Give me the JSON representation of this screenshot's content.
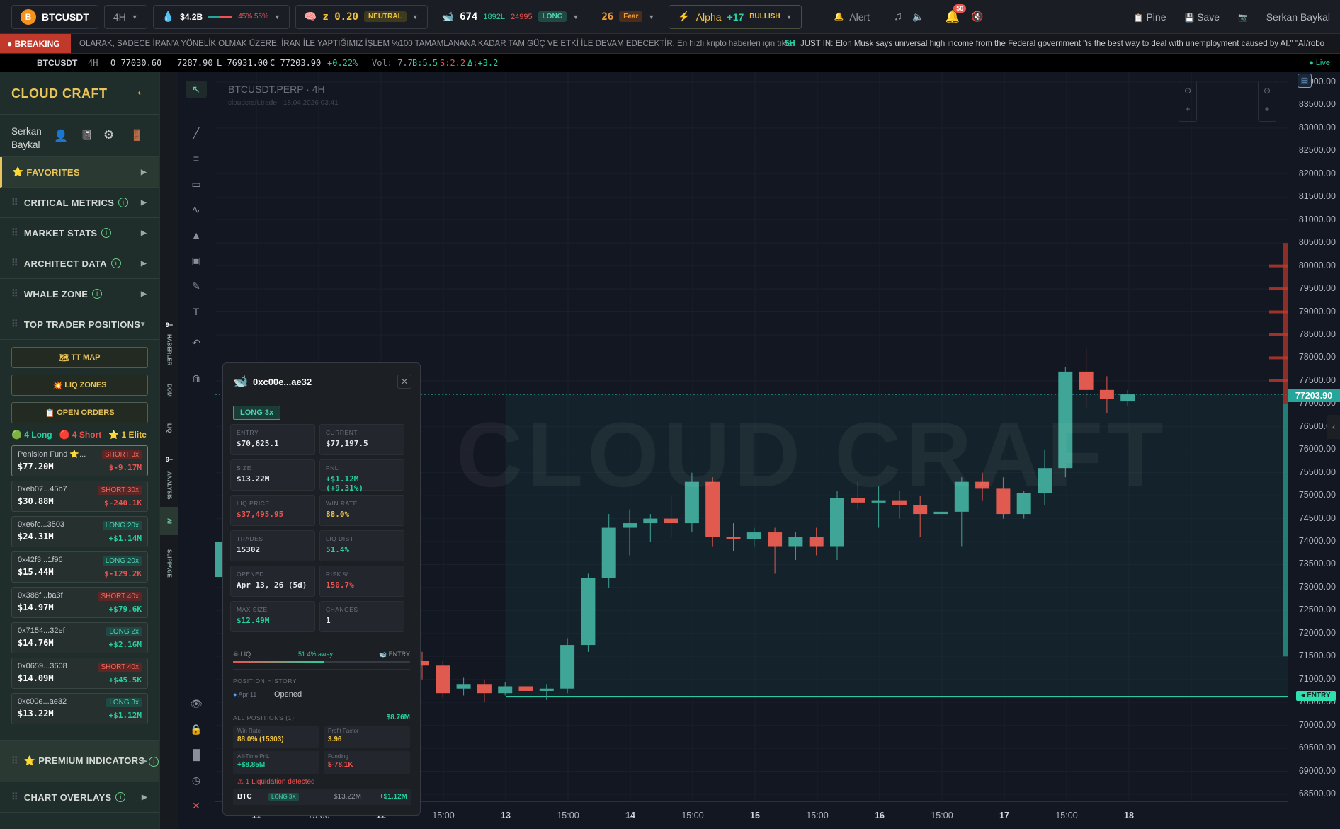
{
  "topbar": {
    "symbol": "BTCUSDT",
    "timeframe": "4H",
    "liquidity_value": "$4.2B",
    "liquidity_split": "45% 55%",
    "zscore_label": "z 0.20",
    "zscore_tag": "NEUTRAL",
    "whale_count": "674",
    "whale_long": "1892L",
    "whale_short": "24995",
    "whale_tag": "LONG",
    "fear_value": "26",
    "fear_label": "Fear",
    "alpha_label": "Alpha",
    "alpha_value": "+17",
    "alpha_tag": "BULLISH",
    "alert_label": "Alert",
    "notif_count": "50",
    "pine_label": "Pine",
    "save_label": "Save",
    "user_name": "Serkan Baykal"
  },
  "breaking": {
    "label": "BREAKING",
    "text1": "OLARAK, SADECE İRAN'A YÖNELİK OLMAK ÜZERE, İRAN İLE YAPTIĞIMIZ İŞLEM %100 TAMAMLANANA KADAR TAM GÜÇ VE ETKİ İLE DEVAM EDECEKTİR. En hızlı kripto haberleri için tıkla",
    "sep": "»",
    "time2": "5H",
    "text2": "JUST IN: Elon Musk says universal high income from the Federal government \"is the best way to deal with unemployment caused by AI.\" \"AI/robo"
  },
  "ohlc": {
    "symbol": "BTCUSDT",
    "tf": "4H",
    "open": "O 77030.60",
    "high": "7287.90",
    "low": "L 76931.00",
    "close": "C 77203.90",
    "change": "+0.22%",
    "vol": "Vol: 7.7",
    "buy": "B:5.5",
    "sell": "S:2.2",
    "delta": "Δ:+3.2",
    "live": "Live"
  },
  "sidebar": {
    "brand": "CLOUD CRAFT",
    "user_first": "Serkan",
    "user_last": "Baykal",
    "sections": [
      "FAVORITES",
      "CRITICAL METRICS",
      "MARKET STATS",
      "ARCHITECT DATA",
      "WHALE ZONE",
      "TOP TRADER POSITIONS"
    ],
    "buttons": [
      "TT MAP",
      "LIQ ZONES",
      "OPEN ORDERS"
    ],
    "summary": {
      "long": "4 Long",
      "short": "4 Short",
      "elite": "1 Elite"
    },
    "traders": [
      {
        "name": "Penision Fund ⭐...",
        "size": "$77.20M",
        "pos": "SHORT 3x",
        "pnl": "$-9.17M",
        "side": "short"
      },
      {
        "name": "0xeb07...45b7",
        "size": "$30.88M",
        "pos": "SHORT 30x",
        "pnl": "$-240.1K",
        "side": "short"
      },
      {
        "name": "0xe6fc...3503",
        "size": "$24.31M",
        "pos": "LONG 20x",
        "pnl": "+$1.14M",
        "side": "long"
      },
      {
        "name": "0x42f3...1f96",
        "size": "$15.44M",
        "pos": "LONG 20x",
        "pnl": "$-129.2K",
        "side": "long"
      },
      {
        "name": "0x388f...ba3f",
        "size": "$14.97M",
        "pos": "SHORT 40x",
        "pnl": "+$79.6K",
        "side": "short"
      },
      {
        "name": "0x7154...32ef",
        "size": "$14.76M",
        "pos": "LONG 2x",
        "pnl": "+$2.16M",
        "side": "long"
      },
      {
        "name": "0x0659...3608",
        "size": "$14.09M",
        "pos": "SHORT 40x",
        "pnl": "+$45.5K",
        "side": "short"
      },
      {
        "name": "0xc00e...ae32",
        "size": "$13.22M",
        "pos": "LONG 3x",
        "pnl": "+$1.12M",
        "side": "long"
      }
    ],
    "premium": "PREMIUM INDICATORS",
    "overlays": "CHART OVERLAYS"
  },
  "vtabs": {
    "badge1": "9+",
    "tab1": "HABERLER",
    "tab2": "DOM",
    "tab3": "LIQ",
    "badge2": "9+",
    "tab4": "ANALYSIS",
    "tab5": "AI",
    "tab6": "SLIPPAGE"
  },
  "chart": {
    "title": "BTCUSDT.PERP · 4H",
    "subtitle": "cloudcraft.trade · 18.04.2026 03:41",
    "watermark": "CLOUD CRAFT",
    "last_price": "77203.90",
    "entry_label": "ENTRY",
    "price_ticks": [
      "84000.00",
      "83500.00",
      "83000.00",
      "82500.00",
      "82000.00",
      "81500.00",
      "81000.00",
      "80500.00",
      "80000.00",
      "79500.00",
      "79000.00",
      "78500.00",
      "78000.00",
      "77500.00",
      "77000.00",
      "76500.00",
      "76000.00",
      "75500.00",
      "75000.00",
      "74500.00",
      "74000.00",
      "73500.00",
      "73000.00",
      "72500.00",
      "72000.00",
      "71500.00",
      "71000.00",
      "70500.00",
      "70000.00",
      "69500.00",
      "69000.00",
      "68500.00"
    ],
    "time_ticks": [
      "11",
      "15:00",
      "12",
      "15:00",
      "13",
      "15:00",
      "14",
      "15:00",
      "15",
      "15:00",
      "16",
      "15:00",
      "17",
      "15:00",
      "18"
    ]
  },
  "chart_data": {
    "type": "candlestick",
    "title": "BTCUSDT.PERP · 4H",
    "ylim": [
      68300,
      84200
    ],
    "entry": 70625.1,
    "last": 77203.9,
    "candles": [
      {
        "o": 71400,
        "h": 71600,
        "l": 71000,
        "c": 71300
      },
      {
        "o": 71300,
        "h": 71400,
        "l": 70600,
        "c": 70700
      },
      {
        "o": 70800,
        "h": 71050,
        "l": 70650,
        "c": 70900
      },
      {
        "o": 70900,
        "h": 71000,
        "l": 70500,
        "c": 70700
      },
      {
        "o": 70700,
        "h": 70950,
        "l": 70650,
        "c": 70850
      },
      {
        "o": 70850,
        "h": 70950,
        "l": 70600,
        "c": 70750
      },
      {
        "o": 70750,
        "h": 70900,
        "l": 70550,
        "c": 70800
      },
      {
        "o": 70800,
        "h": 71900,
        "l": 70700,
        "c": 71750
      },
      {
        "o": 71750,
        "h": 73300,
        "l": 71600,
        "c": 73200
      },
      {
        "o": 73200,
        "h": 74600,
        "l": 73000,
        "c": 74300
      },
      {
        "o": 74300,
        "h": 74700,
        "l": 73700,
        "c": 74400
      },
      {
        "o": 74400,
        "h": 74600,
        "l": 74000,
        "c": 74500
      },
      {
        "o": 74500,
        "h": 75000,
        "l": 74100,
        "c": 74400
      },
      {
        "o": 74400,
        "h": 75500,
        "l": 74200,
        "c": 75300
      },
      {
        "o": 75300,
        "h": 75400,
        "l": 73900,
        "c": 74100
      },
      {
        "o": 74100,
        "h": 74400,
        "l": 73800,
        "c": 74050
      },
      {
        "o": 74050,
        "h": 74300,
        "l": 73900,
        "c": 74200
      },
      {
        "o": 74200,
        "h": 74300,
        "l": 73300,
        "c": 73900
      },
      {
        "o": 73900,
        "h": 74200,
        "l": 73600,
        "c": 74100
      },
      {
        "o": 74100,
        "h": 74300,
        "l": 73700,
        "c": 73900
      },
      {
        "o": 73900,
        "h": 75100,
        "l": 73600,
        "c": 74950
      },
      {
        "o": 74950,
        "h": 75300,
        "l": 74700,
        "c": 74850
      },
      {
        "o": 74850,
        "h": 75200,
        "l": 74300,
        "c": 74900
      },
      {
        "o": 74900,
        "h": 75100,
        "l": 74500,
        "c": 74800
      },
      {
        "o": 74800,
        "h": 75000,
        "l": 74100,
        "c": 74600
      },
      {
        "o": 74600,
        "h": 75400,
        "l": 73350,
        "c": 74650
      },
      {
        "o": 74650,
        "h": 75400,
        "l": 73900,
        "c": 75300
      },
      {
        "o": 75300,
        "h": 75500,
        "l": 74900,
        "c": 75150
      },
      {
        "o": 75150,
        "h": 75400,
        "l": 74500,
        "c": 74600
      },
      {
        "o": 74600,
        "h": 75100,
        "l": 74500,
        "c": 75050
      },
      {
        "o": 75050,
        "h": 76000,
        "l": 74800,
        "c": 75600
      },
      {
        "o": 75600,
        "h": 77800,
        "l": 75400,
        "c": 77700
      },
      {
        "o": 77700,
        "h": 78200,
        "l": 76900,
        "c": 77300
      },
      {
        "o": 77300,
        "h": 77600,
        "l": 76800,
        "c": 77100
      },
      {
        "o": 77050,
        "h": 77300,
        "l": 76950,
        "c": 77204
      }
    ]
  },
  "popup": {
    "title": "0xc00e...ae32",
    "badge": "LONG 3x",
    "cells": [
      {
        "label": "ENTRY",
        "value": "$70,625.1",
        "color": "#e6e8ec"
      },
      {
        "label": "CURRENT",
        "value": "$77,197.5",
        "color": "#e6e8ec"
      },
      {
        "label": "SIZE",
        "value": "$13.22M",
        "color": "#e6e8ec"
      },
      {
        "label": "PNL",
        "value": "+$1.12M (+9.31%)",
        "color": "#26d0a0"
      },
      {
        "label": "LIQ PRICE",
        "value": "$37,495.95",
        "color": "#ef5350"
      },
      {
        "label": "WIN RATE",
        "value": "88.0%",
        "color": "#f0c33c"
      },
      {
        "label": "TRADES",
        "value": "15302",
        "color": "#e6e8ec"
      },
      {
        "label": "LIQ DIST",
        "value": "51.4%",
        "color": "#26d0a0"
      },
      {
        "label": "OPENED",
        "value": "Apr 13, 26 (5d)",
        "color": "#e6e8ec"
      },
      {
        "label": "RISK %",
        "value": "150.7%",
        "color": "#ef5350"
      },
      {
        "label": "MAX SIZE",
        "value": "$12.49M",
        "color": "#26d0a0"
      },
      {
        "label": "CHANGES",
        "value": "1",
        "color": "#e6e8ec"
      }
    ],
    "liq_label": "LIQ",
    "away": "51.4% away",
    "entry_label": "ENTRY",
    "liq_distance_pct": 51.4,
    "history_title": "POSITION HISTORY",
    "history_date": "Apr 11",
    "history_event": "Opened",
    "all_positions": "ALL POSITIONS (1)",
    "all_total": "$8.76M",
    "stats": [
      {
        "label": "Win Rate",
        "value": "88.0% (15303)",
        "color": "#f0c33c"
      },
      {
        "label": "Profit Factor",
        "value": "3.96",
        "color": "#f0c33c"
      },
      {
        "label": "All-Time PnL",
        "value": "+$8.85M",
        "color": "#26d0a0"
      },
      {
        "label": "Funding",
        "value": "$-78.1K",
        "color": "#ef5350"
      }
    ],
    "warning": "⚠ 1 Liquidation detected",
    "footer_coin": "BTC",
    "footer_pos": "LONG 3X",
    "footer_size": "$13.22M",
    "footer_pnl": "+$1.12M"
  }
}
